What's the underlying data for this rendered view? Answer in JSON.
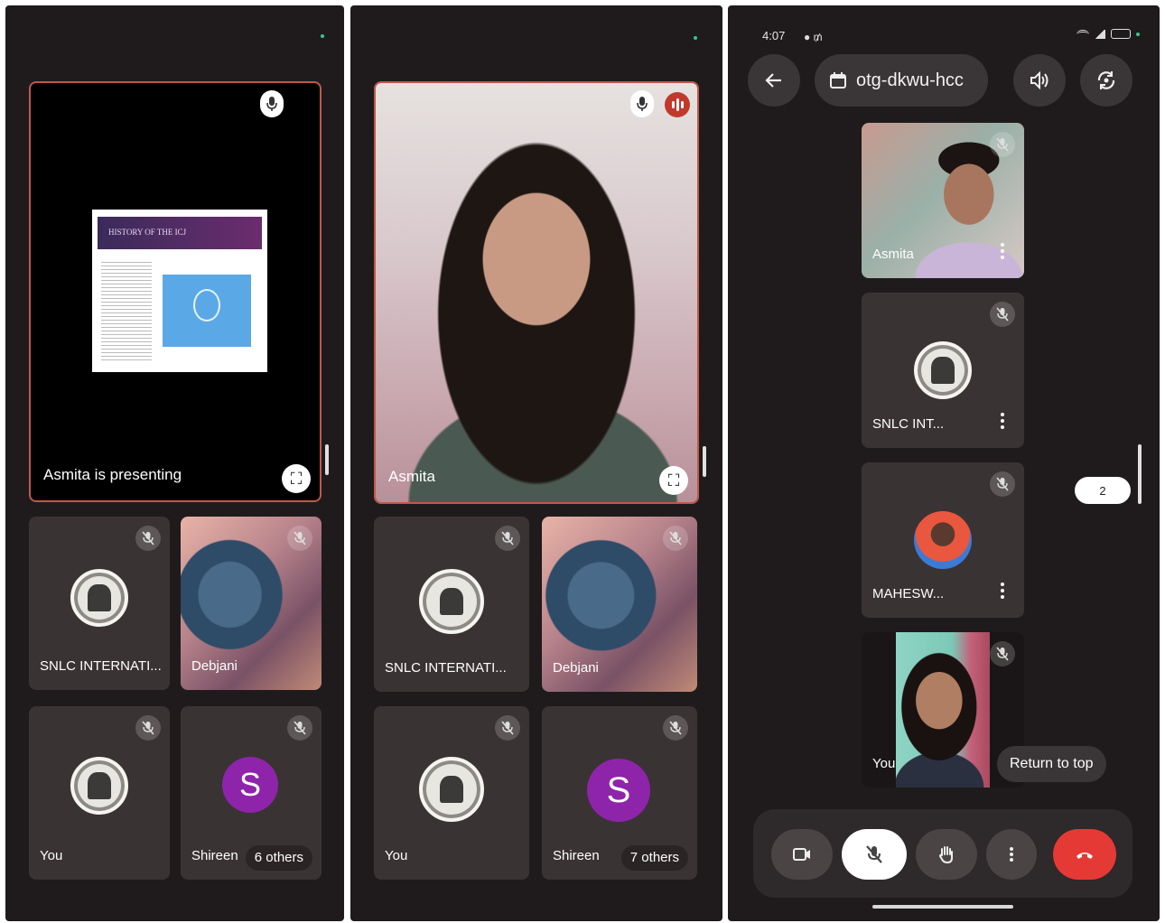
{
  "phone1": {
    "stage_label": "Asmita is presenting",
    "slide_title": "HISTORY OF THE ICJ",
    "tiles": [
      {
        "name": "SNLC INTERNATI..."
      },
      {
        "name": "Debjani"
      },
      {
        "name": "You"
      },
      {
        "name": "Shireen",
        "avatar_letter": "S",
        "others": "6 others"
      }
    ]
  },
  "phone2": {
    "stage_label": "Asmita",
    "tiles": [
      {
        "name": "SNLC INTERNATI..."
      },
      {
        "name": "Debjani"
      },
      {
        "name": "You"
      },
      {
        "name": "Shireen",
        "avatar_letter": "S",
        "others": "7 others"
      }
    ]
  },
  "phone3": {
    "status_time": "4:07",
    "meeting_code": "otg-dkwu-hcc",
    "tiles": [
      {
        "name": "Asmita"
      },
      {
        "name": "SNLC INT..."
      },
      {
        "name": "MAHESW..."
      },
      {
        "name": "You"
      }
    ],
    "page_indicator": "2",
    "return_to_top": "Return to top"
  },
  "colors": {
    "background": "#1f1b1c",
    "tile": "#3a3334",
    "active_border": "#c0574a",
    "avatar_purple": "#8e24aa",
    "hangup_red": "#e53935"
  },
  "icons": [
    "mic-icon",
    "mic-off-icon",
    "fullscreen-icon",
    "audio-level-icon",
    "back-arrow-icon",
    "calendar-icon",
    "speaker-icon",
    "switch-camera-icon",
    "camera-icon",
    "raise-hand-icon",
    "more-vert-icon",
    "hang-up-icon"
  ]
}
